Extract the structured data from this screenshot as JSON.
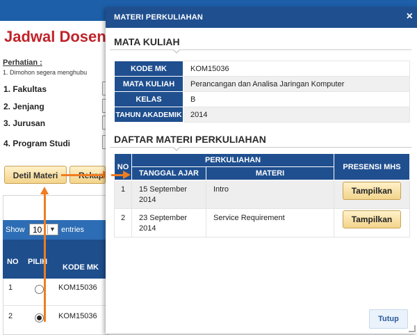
{
  "background": {
    "page_title": "Jadwal Dosen",
    "perhatian_label": "Perhatian :",
    "note": "1. Dimohon segera menghubu",
    "filters": [
      {
        "label": "1. Fakultas"
      },
      {
        "label": "2. Jenjang"
      },
      {
        "label": "3. Jurusan"
      },
      {
        "label": "4. Program Studi"
      }
    ],
    "detil_button": "Detil Materi",
    "rekap_button": "Rekap",
    "show_label": "Show",
    "show_value": "10",
    "entries_label": "entries",
    "table_headers": {
      "no": "NO",
      "pilih": "PILIH",
      "kode": "KODE MK"
    },
    "rows": [
      {
        "no": "1",
        "kode": "KOM15036",
        "selected": false
      },
      {
        "no": "2",
        "kode": "KOM15036",
        "selected": true
      }
    ]
  },
  "modal": {
    "title": "MATERI PERKULIAHAN",
    "close_symbol": "×",
    "section_mata_kuliah": "MATA KULIAH",
    "info": {
      "kode_mk_label": "KODE MK",
      "kode_mk": "KOM15036",
      "mata_kuliah_label": "MATA KULIAH",
      "mata_kuliah": "Perancangan dan Analisa Jaringan Komputer",
      "kelas_label": "KELAS",
      "kelas": "B",
      "tahun_label": "TAHUN AKADEMIK",
      "tahun": "2014"
    },
    "section_daftar": "DAFTAR MATERI PERKULIAHAN",
    "materi_headers": {
      "no": "NO",
      "perkuliahan": "PERKULIAHAN",
      "tanggal": "TANGGAL AJAR",
      "materi": "MATERI",
      "presensi": "PRESENSI MHS"
    },
    "materi_rows": [
      {
        "no": "1",
        "tanggal": "15 September 2014",
        "materi": "Intro",
        "button": "Tampilkan"
      },
      {
        "no": "2",
        "tanggal": "23 September 2014",
        "materi": "Service Requirement",
        "button": "Tampilkan"
      }
    ],
    "tutup_button": "Tutup"
  },
  "colors": {
    "header_blue": "#1f4f8f",
    "accent_red": "#c0232a",
    "annotation_orange": "#ef7d22",
    "button_gold": "#f2d48b"
  }
}
